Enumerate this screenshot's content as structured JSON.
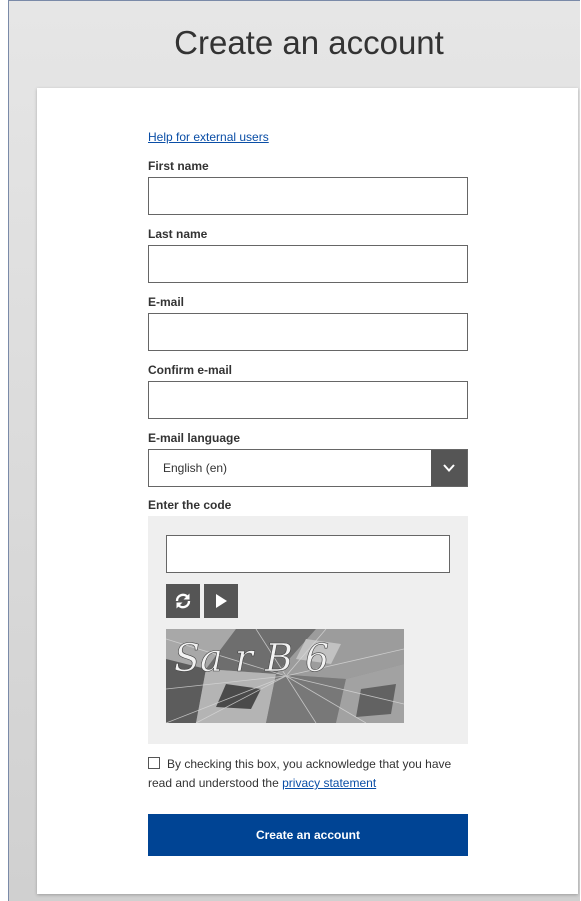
{
  "page": {
    "title": "Create an account"
  },
  "form": {
    "help_link": "Help for external users",
    "first_name_label": "First name",
    "first_name_value": "",
    "last_name_label": "Last name",
    "last_name_value": "",
    "email_label": "E-mail",
    "email_value": "",
    "confirm_email_label": "Confirm e-mail",
    "confirm_email_value": "",
    "language_label": "E-mail language",
    "language_value": "English (en)",
    "code_label": "Enter the code",
    "code_value": "",
    "captcha_text": "Sa r B 6",
    "consent_text": "By checking this box, you acknowledge that you have read and understood the",
    "privacy_link": "privacy statement",
    "submit_label": "Create an account"
  },
  "colors": {
    "primary_button": "#004494",
    "link": "#0a4ea6",
    "icon_button": "#555555"
  }
}
